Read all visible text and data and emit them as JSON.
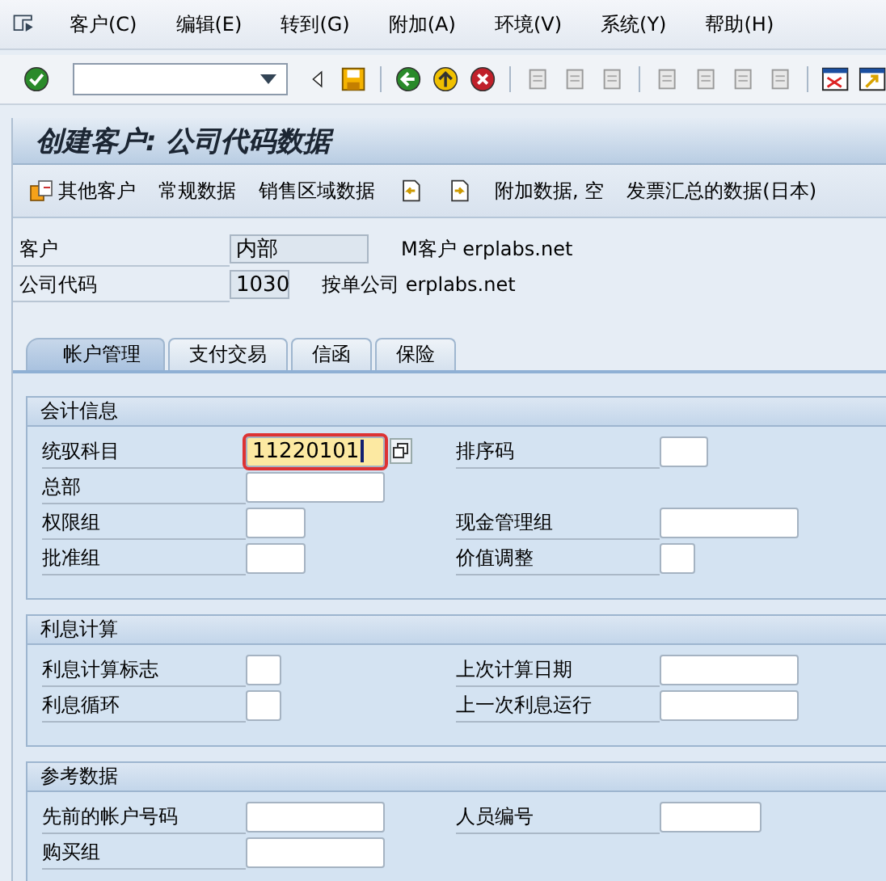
{
  "menu": [
    {
      "label": "客户(C)"
    },
    {
      "label": "编辑(E)"
    },
    {
      "label": "转到(G)"
    },
    {
      "label": "附加(A)"
    },
    {
      "label": "环境(V)"
    },
    {
      "label": "系统(Y)"
    },
    {
      "label": "帮助(H)"
    }
  ],
  "screen_title": "创建客户: 公司代码数据",
  "app_toolbar": [
    {
      "kind": "icon-text",
      "label": "其他客户"
    },
    {
      "kind": "text",
      "label": "常规数据"
    },
    {
      "kind": "text",
      "label": "销售区域数据"
    },
    {
      "kind": "prev"
    },
    {
      "kind": "next"
    },
    {
      "kind": "text",
      "label": "附加数据, 空"
    },
    {
      "kind": "text",
      "label": "发票汇总的数据(日本)"
    }
  ],
  "header": [
    {
      "label": "客户",
      "value": "内部",
      "kind": "long",
      "description": "M客户 erplabs.net"
    },
    {
      "label": "公司代码",
      "value": "1030",
      "kind": "short",
      "description": "按单公司 erplabs.net"
    }
  ],
  "tabs": [
    {
      "label": "帐户管理",
      "selected": true
    },
    {
      "label": "支付交易",
      "selected": false
    },
    {
      "label": "信函",
      "selected": false
    },
    {
      "label": "保险",
      "selected": false
    }
  ],
  "sections": [
    {
      "title": "会计信息",
      "rows": [
        {
          "left": {
            "label": "统驭科目",
            "value": "11220101",
            "kind": "long",
            "focused": true
          },
          "right": {
            "label": "排序码",
            "kind": "small"
          }
        },
        {
          "left": {
            "label": "总部",
            "kind": "long"
          }
        },
        {
          "left": {
            "label": "权限组",
            "kind": "short"
          },
          "right": {
            "label": "现金管理组",
            "kind": "long"
          }
        },
        {
          "left": {
            "label": "批准组",
            "kind": "short"
          },
          "right": {
            "label": "价值调整",
            "kind": "tiny"
          }
        }
      ]
    },
    {
      "title": "利息计算",
      "rows": [
        {
          "left": {
            "label": "利息计算标志",
            "kind": "tiny"
          },
          "right": {
            "label": "上次计算日期",
            "kind": "long"
          }
        },
        {
          "left": {
            "label": "利息循环",
            "kind": "tiny"
          },
          "right": {
            "label": "上一次利息运行",
            "kind": "long"
          }
        }
      ]
    },
    {
      "title": "参考数据",
      "rows": [
        {
          "left": {
            "label": "先前的帐户号码",
            "kind": "long"
          },
          "right": {
            "label": "人员编号",
            "kind": "medium"
          }
        },
        {
          "left": {
            "label": "购买组",
            "kind": "long"
          }
        }
      ]
    }
  ]
}
